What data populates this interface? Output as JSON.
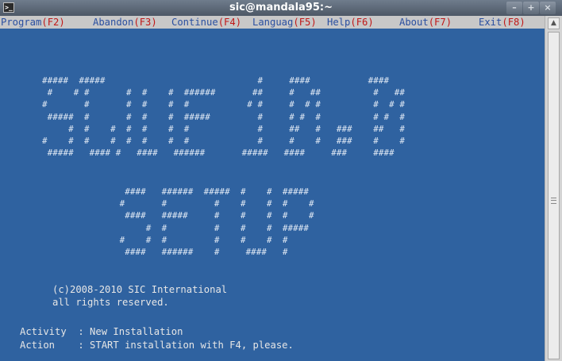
{
  "window": {
    "title": "sic@mandala95:~",
    "minimize_glyph": "–",
    "maximize_glyph": "+",
    "close_glyph": "×",
    "app_icon_glyph": ">_"
  },
  "menu": {
    "items": [
      {
        "label": "Program",
        "key": "(F2)"
      },
      {
        "label": "Abandon",
        "key": "(F3)"
      },
      {
        "label": "Continue",
        "key": "(F4)"
      },
      {
        "label": "Languag",
        "key": "(F5)"
      },
      {
        "label": "Help",
        "key": "(F6)"
      },
      {
        "label": "About",
        "key": "(F7)"
      },
      {
        "label": "Exit",
        "key": "(F8)"
      }
    ]
  },
  "banner": {
    "line1": "#####  #####                             #     ####           ####\n #    # #       #  #    #  ######       ##     #   ##          #   ##\n#       #       #  #    #  #           # #     #  # #          #  # #\n #####  #       #  #    #  #####         #     # #  #          # #  #\n     #  #    #  #  #    #  #             #     ##   #   ###    ##   #\n#    #  #    #  #  #    #  #             #     #    #   ###    #    #\n #####   #### #   ####   ######       #####   ####     ###     ####",
    "line2": "  ####   ######  #####  #    #  #####\n #       #         #    #    #  #    #\n  ####   #####     #    #    #  #    #\n      #  #         #    #    #  #####\n #    #  #         #    #    #  #\n  ####   ######    #     ####   #"
  },
  "copyright": {
    "line1": "(c)2008-2010 SIC International",
    "line2": "all rights reserved."
  },
  "status": {
    "activity": "Activity  : New Installation",
    "action": "Action    : START installation with F4, please."
  },
  "colors": {
    "terminal_bg": "#2f62a0",
    "menu_bg": "#c8c8c8",
    "menu_text": "#2a4fa0",
    "menu_key": "#c01818",
    "text": "#e6e6e6"
  }
}
